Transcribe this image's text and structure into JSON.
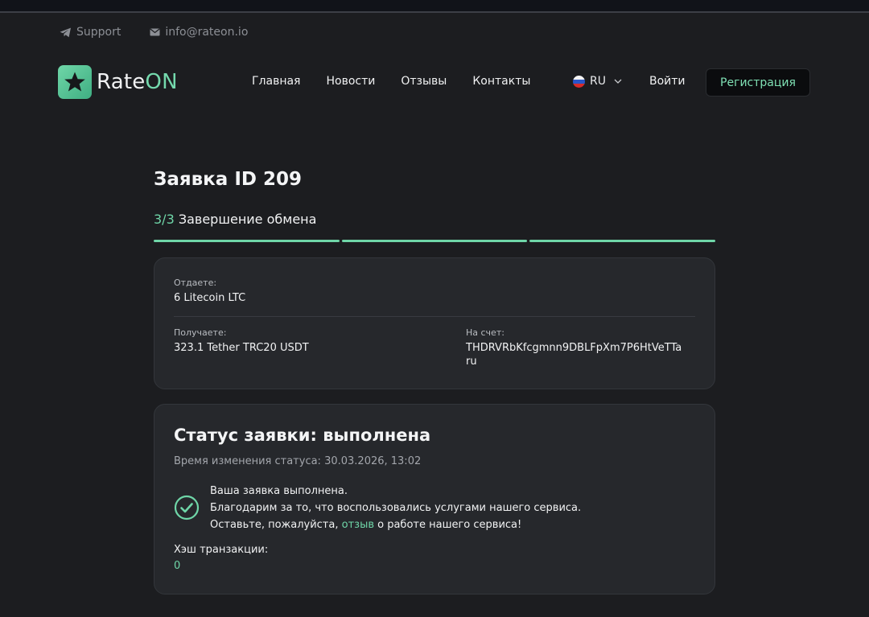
{
  "top_links": {
    "support": "Support",
    "email": "info@rateon.io"
  },
  "logo": {
    "part1": "Rate",
    "part2": "ON"
  },
  "nav": {
    "items": [
      "Главная",
      "Новости",
      "Отзывы",
      "Контакты"
    ]
  },
  "header": {
    "language": "RU",
    "login": "Войти",
    "register": "Регистрация"
  },
  "order": {
    "title": "Заявка ID 209",
    "step_num": "3/3",
    "step_label": "Завершение обмена",
    "progress_segments_completed": 3,
    "progress_segments_total": 3
  },
  "details": {
    "give_label": "Отдаете:",
    "give_value": "6 Litecoin LTC",
    "receive_label": "Получаете:",
    "receive_value": "323.1 Tether TRC20 USDT",
    "account_label": "На счет:",
    "account_line1": "THDRVRbKfcgmnn9DBLFpXm7P6HtVeTTa",
    "account_line2": "ru"
  },
  "status": {
    "title": "Статус заявки: выполнена",
    "time": "Время изменения статуса: 30.03.2026, 13:02",
    "msg_line1": "Ваша заявка выполнена.",
    "msg_line2": "Благодарим за то, что воспользовались услугами нашего сервиса.",
    "msg_line3_pre": "Оставьте, пожалуйста, ",
    "msg_link": "отзыв",
    "msg_line3_post": " о работе нашего сервиса!",
    "hash_label": "Хэш транзакции:",
    "hash_value": "0"
  },
  "colors": {
    "accent": "#6fd6a8",
    "background": "#1c1d20",
    "card": "#26282c"
  }
}
